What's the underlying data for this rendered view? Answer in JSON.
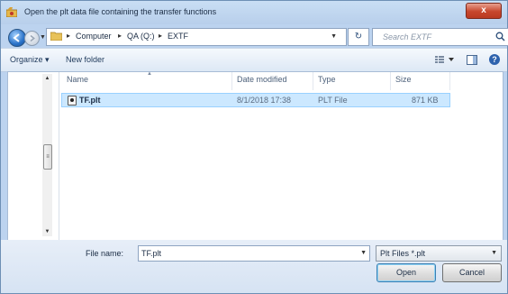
{
  "window": {
    "title": "Open the plt data file containing the transfer functions",
    "close_label": "x"
  },
  "address": {
    "crumbs": [
      "Computer",
      "QA (Q:)",
      "EXTF"
    ],
    "separator": "▸",
    "search_placeholder": "Search EXTF"
  },
  "toolbar": {
    "organize_label": "Organize ▾",
    "new_folder_label": "New folder"
  },
  "columns": {
    "name": "Name",
    "date": "Date modified",
    "type": "Type",
    "size": "Size"
  },
  "files": [
    {
      "name": "TF.plt",
      "date": "8/1/2018 17:38",
      "type": "PLT File",
      "size": "871 KB",
      "selected": true
    }
  ],
  "footer": {
    "filename_label": "File name:",
    "filename_value": "TF.plt",
    "filter_value": "Plt Files *.plt",
    "open_label": "Open",
    "cancel_label": "Cancel"
  },
  "colors": {
    "selection": "#cce8ff",
    "window_frame": "#bcd3ef",
    "close_button": "#c7462d"
  }
}
